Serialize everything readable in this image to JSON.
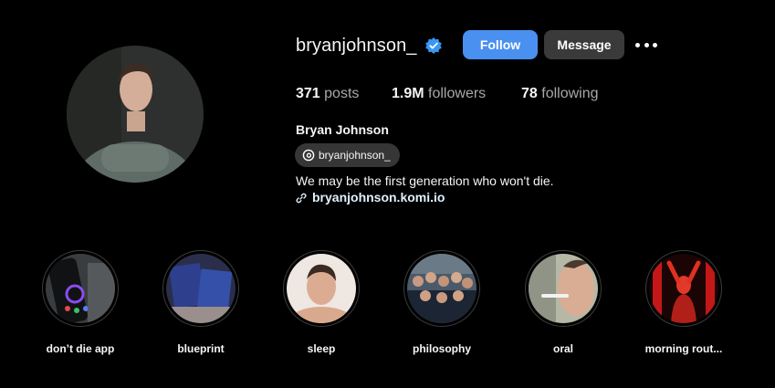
{
  "profile": {
    "username": "bryanjohnson_",
    "verified": true,
    "full_name": "Bryan Johnson",
    "threads_handle": "bryanjohnson_",
    "bio": "We may be the first generation who won't die.",
    "link": "bryanjohnson.komi.io"
  },
  "actions": {
    "follow_label": "Follow",
    "message_label": "Message"
  },
  "stats": {
    "posts_count": "371",
    "posts_label": "posts",
    "followers_count": "1.9M",
    "followers_label": "followers",
    "following_count": "78",
    "following_label": "following"
  },
  "highlights": [
    {
      "label": "don’t die app"
    },
    {
      "label": "blueprint"
    },
    {
      "label": "sleep"
    },
    {
      "label": "philosophy"
    },
    {
      "label": "oral"
    },
    {
      "label": "morning rout..."
    }
  ],
  "icons": {
    "verified": "verified-badge-icon",
    "more": "more-options-icon",
    "threads": "threads-icon",
    "link": "link-icon"
  },
  "colors": {
    "background": "#000000",
    "follow_button": "#4a90f0",
    "message_button": "#3a3a3a",
    "verified_badge": "#3897f0",
    "secondary_text": "#a8a8a8",
    "link_text": "#e0f1ff"
  }
}
